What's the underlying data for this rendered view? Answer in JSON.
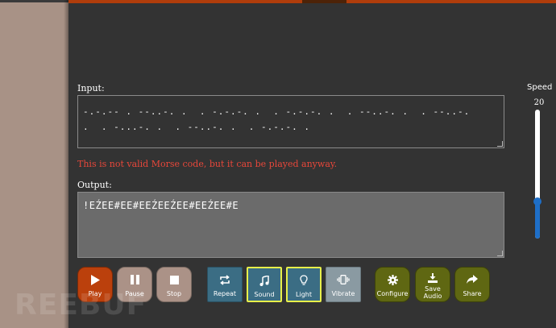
{
  "input": {
    "label": "Input:",
    "value": "-.-.-- . --..-. .  . -.-.-. .  . -.-.-. .  . --..-. .  . --..-.\n.  . -...-. .  . --..-. .  . -.-.-. ."
  },
  "error_message": "This is not valid Morse code, but it can be played anyway.",
  "output": {
    "label": "Output:",
    "value": "!EŹEE#EE#EEŹEEŹEE#EEŹEE#E"
  },
  "speed": {
    "label": "Speed",
    "value": "20",
    "slider_fraction": 0.29
  },
  "buttons": {
    "play": "Play",
    "pause": "Pause",
    "stop": "Stop",
    "repeat": "Repeat",
    "sound": "Sound",
    "light": "Light",
    "vibrate": "Vibrate",
    "configure": "Configure",
    "save_audio": "Save Audio",
    "share": "Share"
  },
  "watermark": "REEBUF",
  "colors": {
    "accent": "#b03d0b",
    "play": "#bb400c",
    "toggle_active_border": "#e8f04a",
    "mode": "#3b6d84",
    "action": "#5f6712",
    "slider": "#1e6fc8",
    "error": "#e8473a"
  }
}
